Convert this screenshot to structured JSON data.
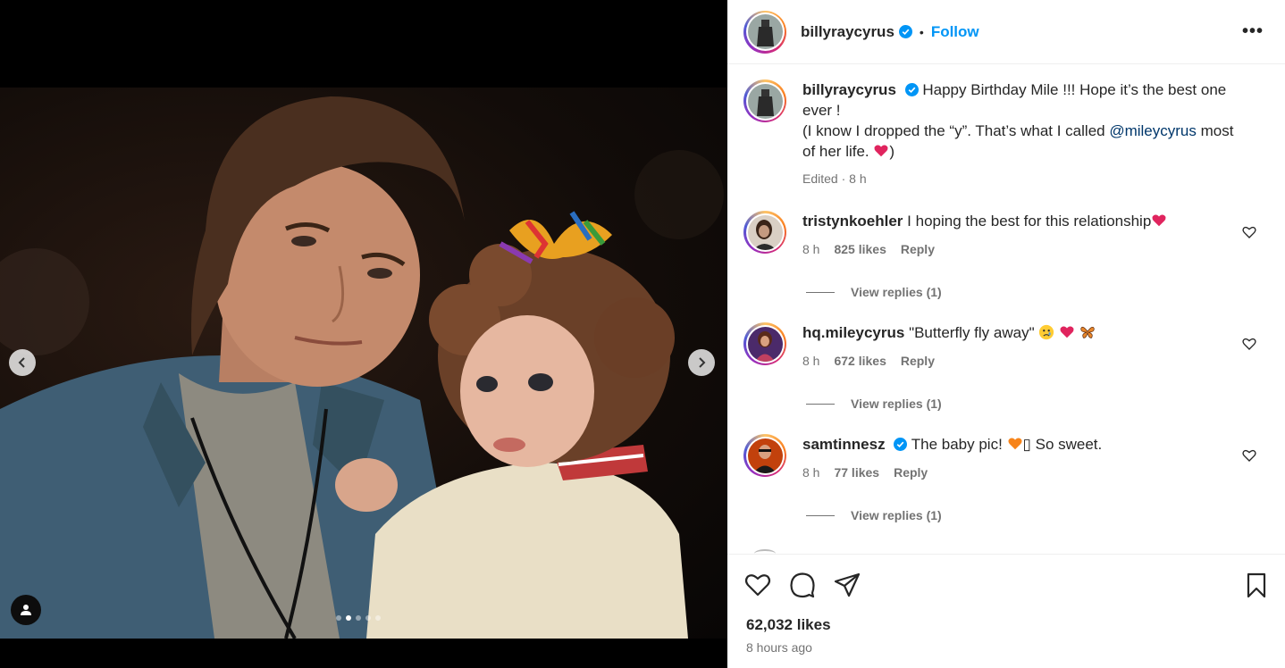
{
  "post": {
    "username": "billyraycyrus",
    "follow_label": "Follow",
    "separator": "•",
    "more_label": "•••",
    "carousel": {
      "slide_count": 5,
      "active_index": 1
    }
  },
  "caption": {
    "username": "billyraycyrus",
    "line1": "Happy Birthday Mile !!! Hope it’s the best one ever !",
    "line2_pre": "(I know I dropped the “y”. That’s what I called ",
    "mention": "@mileycyrus",
    "line2_post": " most of her life. ",
    "line2_end": ")",
    "meta": "Edited · 8 h"
  },
  "comments": [
    {
      "username": "tristynkoehler",
      "verified": false,
      "text": "I hoping the best for this relationship",
      "time": "8 h",
      "likes": "825 likes",
      "reply_label": "Reply",
      "view_replies": "View replies (1)"
    },
    {
      "username": "hq.mileycyrus",
      "verified": false,
      "text": "\"Butterfly fly away\" ",
      "time": "8 h",
      "likes": "672 likes",
      "reply_label": "Reply",
      "view_replies": "View replies (1)"
    },
    {
      "username": "samtinnesz",
      "verified": true,
      "text_pre": "The baby pic! ",
      "text_post": "▯ So sweet.",
      "time": "8 h",
      "likes": "77 likes",
      "reply_label": "Reply",
      "view_replies": "View replies (1)"
    }
  ],
  "footer": {
    "likes": "62,032 likes",
    "time_ago": "8 hours ago"
  },
  "colors": {
    "follow": "#0095f6",
    "verified": "#0095f6",
    "mention": "#00376b",
    "muted": "#737373"
  }
}
